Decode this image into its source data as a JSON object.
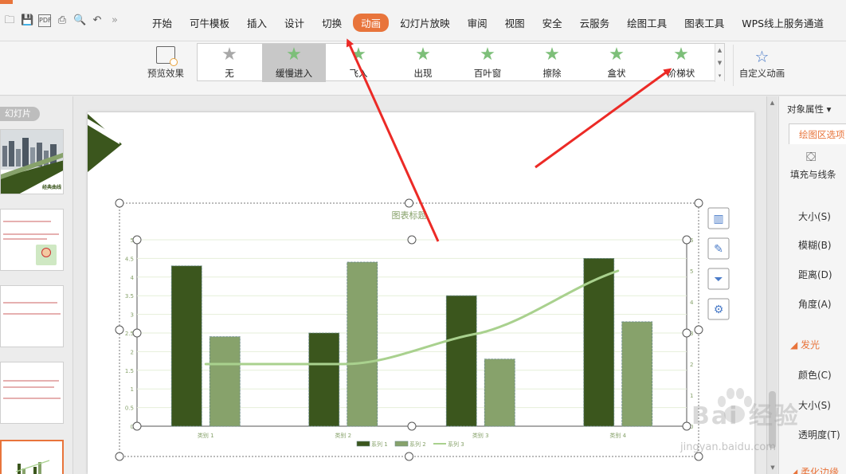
{
  "menu": {
    "items": [
      "开始",
      "可牛模板",
      "插入",
      "设计",
      "切换",
      "动画",
      "幻灯片放映",
      "审阅",
      "视图",
      "安全",
      "云服务",
      "绘图工具",
      "图表工具",
      "WPS线上服务通道"
    ],
    "active_index": 5
  },
  "ribbon": {
    "preview_label": "预览效果",
    "animations": [
      {
        "label": "无",
        "icon": "gray-star-icon"
      },
      {
        "label": "缓慢进入",
        "icon": "green-star-icon",
        "selected": true
      },
      {
        "label": "飞入",
        "icon": "green-star-icon"
      },
      {
        "label": "出现",
        "icon": "green-star-icon"
      },
      {
        "label": "百叶窗",
        "icon": "green-star-icon"
      },
      {
        "label": "擦除",
        "icon": "green-star-icon"
      },
      {
        "label": "盒状",
        "icon": "green-star-icon"
      },
      {
        "label": "阶梯状",
        "icon": "green-star-icon"
      }
    ],
    "custom_label": "自定义动画"
  },
  "slides_panel": {
    "tab_label": "幻灯片",
    "thumb1_caption": "经典曲线"
  },
  "chart_data": {
    "type": "bar",
    "title": "图表标题",
    "categories": [
      "类别 1",
      "类别 2",
      "类别 3",
      "类别 4"
    ],
    "series": [
      {
        "name": "系列 1",
        "type": "bar",
        "values": [
          4.3,
          2.5,
          3.5,
          4.5
        ],
        "color": "#3b561d"
      },
      {
        "name": "系列 2",
        "type": "bar",
        "values": [
          2.4,
          4.4,
          1.8,
          2.8
        ],
        "color": "#87a26b"
      },
      {
        "name": "系列 3",
        "type": "line",
        "axis": "secondary",
        "values": [
          2,
          2,
          3,
          5
        ],
        "color": "#a9d18e"
      }
    ],
    "ylim": [
      0,
      5
    ],
    "yticks": [
      "0",
      "0.5",
      "1",
      "1.5",
      "2",
      "2.5",
      "3",
      "3.5",
      "4",
      "4.5",
      "5"
    ],
    "y2lim": [
      0,
      6
    ],
    "y2ticks": [
      "0",
      "1",
      "2",
      "3",
      "4",
      "5",
      "6"
    ],
    "grid": true,
    "legend": "bottom"
  },
  "chart_tools": [
    "chart-elements-icon",
    "chart-style-brush-icon",
    "chart-filter-icon",
    "chart-settings-gear-icon"
  ],
  "right_panel": {
    "header": "对象属性",
    "tab": "绘图区选项",
    "fill_label": "填充与线条",
    "items": [
      "大小(S)",
      "模糊(B)",
      "距离(D)",
      "角度(A)"
    ],
    "section": "发光",
    "glow_items": [
      "颜色(C)",
      "大小(S)",
      "透明度(T)"
    ],
    "section2": "柔化边缘"
  },
  "colors": {
    "accent": "#e8743b",
    "arrow": "#ec2a26",
    "dark_green": "#3b561d",
    "light_green": "#87a26b",
    "line_green": "#a9d18e"
  },
  "watermark": {
    "main": "Bai 经验",
    "url": "jingyan.baidu.com"
  }
}
